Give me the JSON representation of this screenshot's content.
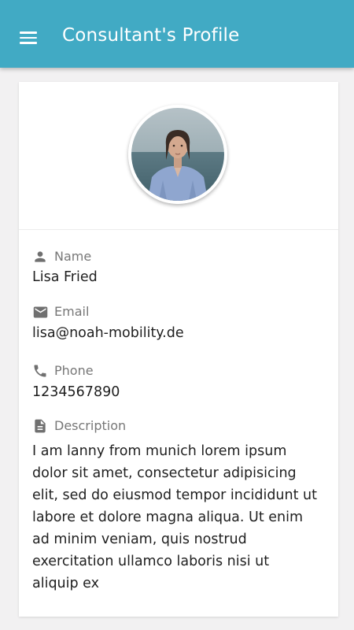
{
  "app_bar": {
    "title": "Consultant's Profile",
    "menu_icon": "menu-icon",
    "background_color": "#41aac4"
  },
  "profile": {
    "avatar_icon": "avatar-photo",
    "fields": {
      "name": {
        "icon": "person-icon",
        "label": "Name",
        "value": "Lisa Fried"
      },
      "email": {
        "icon": "email-icon",
        "label": "Email",
        "value": "lisa@noah-mobility.de"
      },
      "phone": {
        "icon": "phone-icon",
        "label": "Phone",
        "value": "1234567890"
      },
      "description": {
        "icon": "description-icon",
        "label": "Description",
        "value": "I am lanny from munich lorem ipsum\ndolor sit amet, consectetur adipisicing\nelit, sed do eiusmod tempor incididunt ut\nlabore et dolore magna aliqua. Ut enim\nad minim veniam, quis nostrud\nexercitation ullamco laboris nisi ut\naliquip ex"
      }
    }
  }
}
